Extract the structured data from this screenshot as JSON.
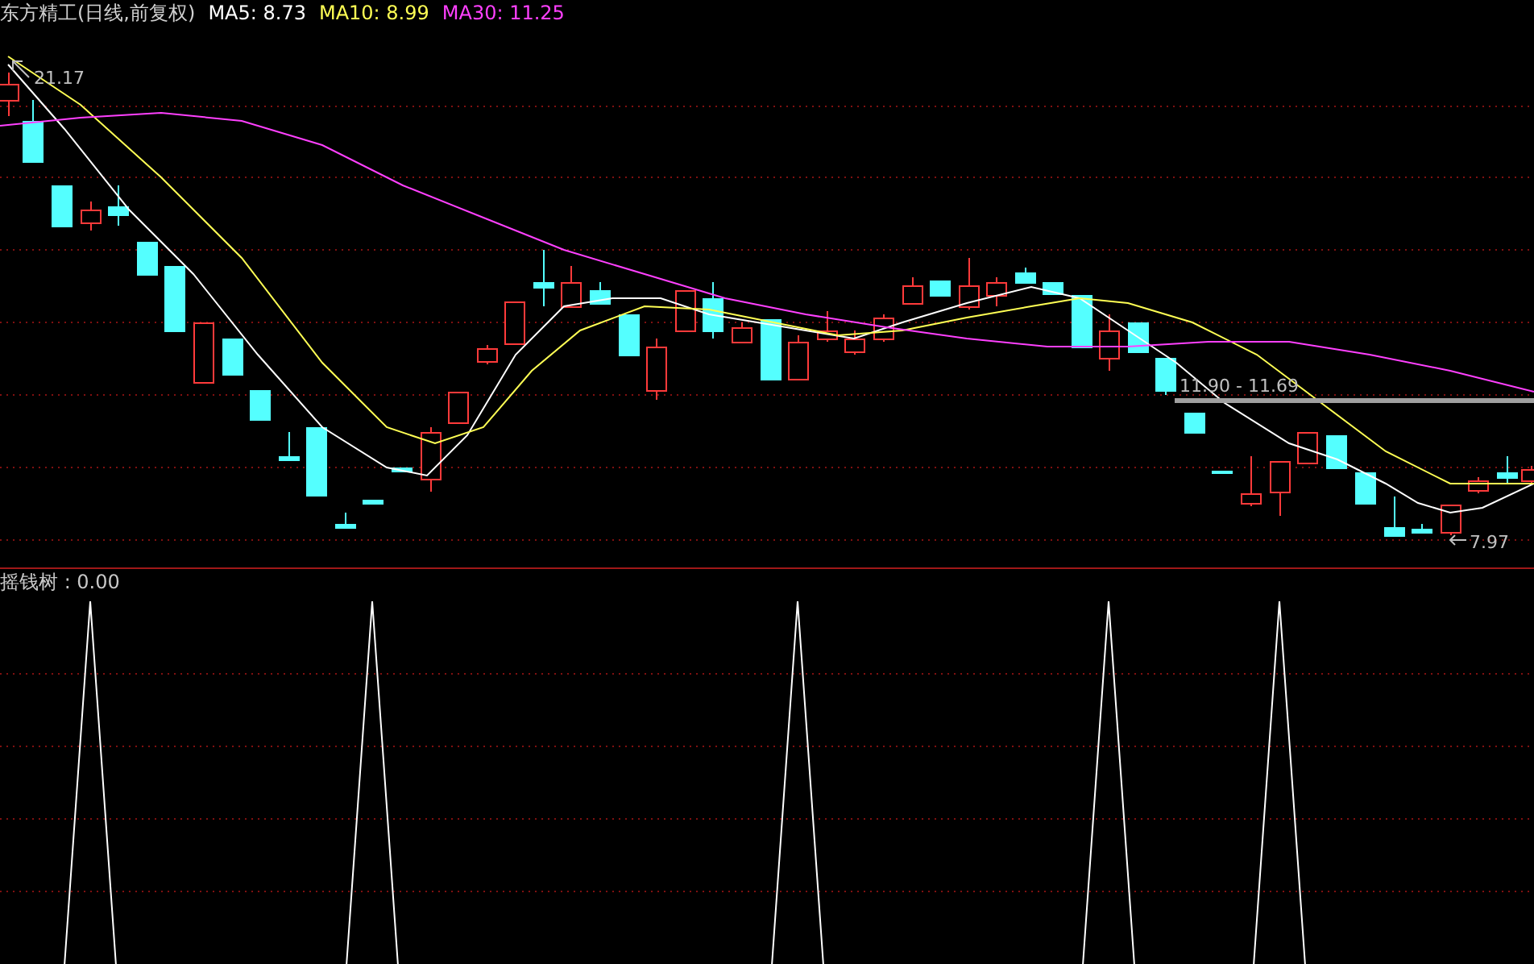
{
  "header": {
    "title": "东方精工(日线,前复权)",
    "indicators": [
      {
        "label": "MA5: 8.73",
        "color": "#ffffff"
      },
      {
        "label": "MA10: 8.99",
        "color": "#ffff54"
      },
      {
        "label": "MA30: 11.25",
        "color": "#ff40ff"
      }
    ]
  },
  "price_chart": {
    "high_label": "21.17",
    "low_label": "7.97",
    "range_label": "11.90 - 11.69"
  },
  "indicator_panel": {
    "label": "摇钱树 : 0.00"
  }
}
